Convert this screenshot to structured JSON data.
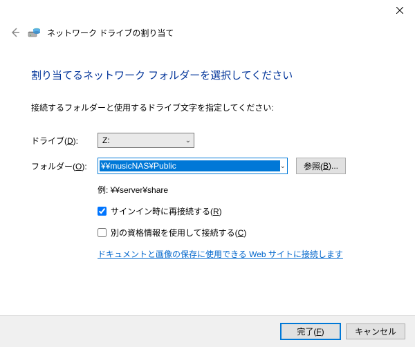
{
  "titlebar": {
    "close_tooltip": "閉じる"
  },
  "header": {
    "title": "ネットワーク ドライブの割り当て"
  },
  "main": {
    "heading": "割り当てるネットワーク フォルダーを選択してください",
    "instruction": "接続するフォルダーと使用するドライブ文字を指定してください:",
    "drive_label_pre": "ドライブ(",
    "drive_label_key": "D",
    "drive_label_post": "):",
    "drive_value": "Z:",
    "folder_label_pre": "フォルダー(",
    "folder_label_key": "O",
    "folder_label_post": "):",
    "folder_value": "¥¥musicNAS¥Public",
    "browse_label_pre": "参照(",
    "browse_label_key": "B",
    "browse_label_post": ")...",
    "example": "例: ¥¥server¥share",
    "reconnect_checked": true,
    "reconnect_label_pre": "サインイン時に再接続する(",
    "reconnect_label_key": "R",
    "reconnect_label_post": ")",
    "credentials_checked": false,
    "credentials_label_pre": "別の資格情報を使用して接続する(",
    "credentials_label_key": "C",
    "credentials_label_post": ")",
    "link_text": "ドキュメントと画像の保存に使用できる Web サイトに接続します"
  },
  "footer": {
    "finish_pre": "完了(",
    "finish_key": "F",
    "finish_post": ")",
    "cancel": "キャンセル"
  }
}
